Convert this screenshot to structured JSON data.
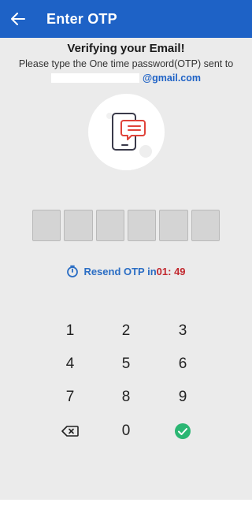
{
  "app_bar": {
    "title": "Enter OTP",
    "back_icon": "arrow-left-icon",
    "color": "#1e62c6"
  },
  "heading": "Verifying your Email!",
  "instruction": "Please type the One time password(OTP) sent to",
  "email_domain": "@gmail.com",
  "illustration_icon": "phone-message-icon",
  "otp": {
    "length": 6,
    "digits": [
      "",
      "",
      "",
      "",
      "",
      ""
    ]
  },
  "resend": {
    "icon": "timer-icon",
    "label": "Resend OTP in",
    "countdown": "01: 49"
  },
  "keypad": {
    "keys": [
      "1",
      "2",
      "3",
      "4",
      "5",
      "6",
      "7",
      "8",
      "9",
      "",
      "0",
      ""
    ],
    "backspace_icon": "backspace-icon",
    "submit_icon": "check-circle-icon",
    "submit_color": "#2bb673"
  }
}
